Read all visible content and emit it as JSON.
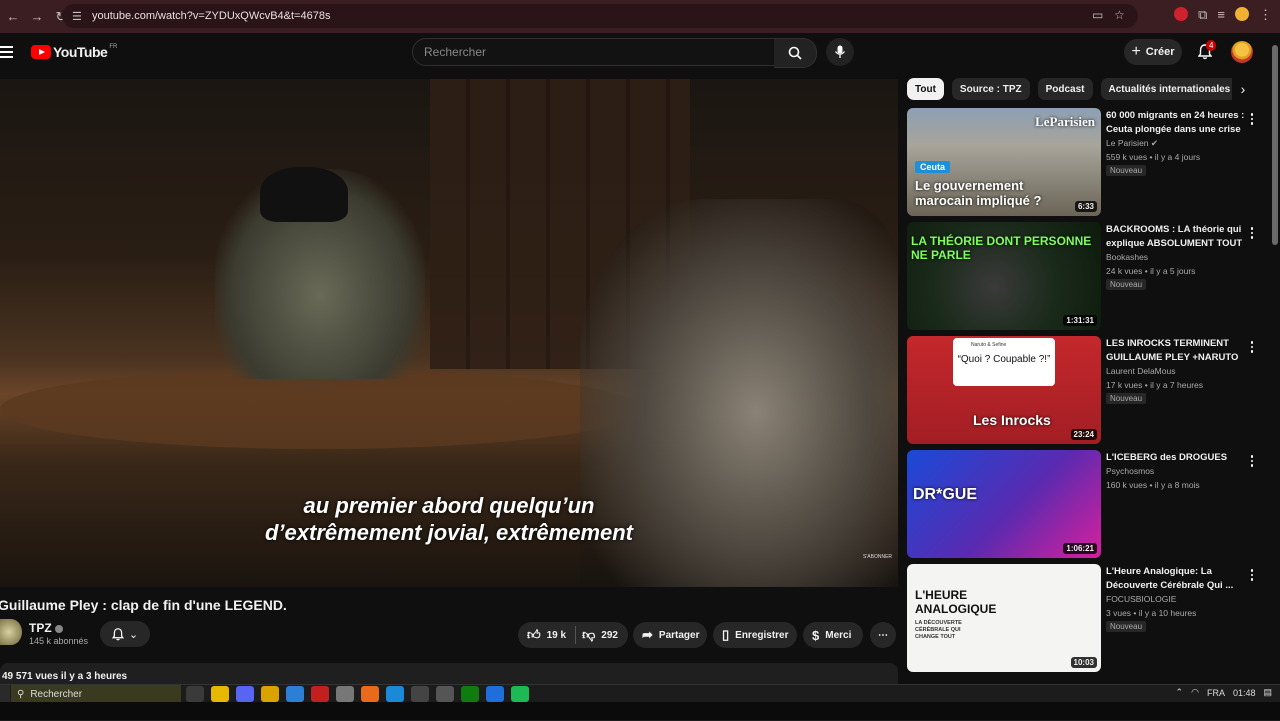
{
  "browser": {
    "url": "youtube.com/watch?v=ZYDUxQWcvB4&t=4678s"
  },
  "header": {
    "logo_text": "YouTube",
    "logo_region": "FR",
    "search_placeholder": "Rechercher",
    "create_label": "Créer",
    "notification_count": "4"
  },
  "player": {
    "subtitle_line1": "au premier abord quelqu’un",
    "subtitle_line2": "d’extrêmement jovial, extrêmement",
    "watermark": "S'ABONNER"
  },
  "video": {
    "title": "Guillaume Pley : clap de fin d'une LEGEND.",
    "channel_name": "TPZ",
    "subscribers": "145 k abonnés",
    "likes": "19 k",
    "dislikes": "292",
    "share_label": "Partager",
    "save_label": "Enregistrer",
    "thanks_label": "Merci",
    "stats": "49 571 vues  il y a 3 heures"
  },
  "chips": [
    "Tout",
    "Source : TPZ",
    "Podcast",
    "Actualités internationales"
  ],
  "recommendations": [
    {
      "title": "60 000 migrants en 24 heures : Ceuta plongée dans une crise ...",
      "channel": "Le Parisien",
      "meta": "559 k vues • il y a 4 jours",
      "badge": "Nouveau",
      "duration": "6:33",
      "thumb_label": "Ceuta",
      "thumb_text": "Le gouvernement marocain impliqué ?",
      "thumb_brand": "LeParisien"
    },
    {
      "title": "BACKROOMS : LA théorie qui explique ABSOLUMENT TOUT ...",
      "channel": "Bookashes",
      "meta": "24 k vues • il y a 5 jours",
      "badge": "Nouveau",
      "duration": "1:31:31",
      "thumb_text": "LA THÉORIE DONT PERSONNE NE PARLE"
    },
    {
      "title": "LES INROCKS TERMINENT GUILLAUME PLEY +NARUTO E...",
      "channel": "Laurent DelaMous",
      "meta": "17 k vues • il y a 7 heures",
      "badge": "Nouveau",
      "duration": "23:24",
      "thumb_text": "“Quoi ? Coupable ?!”",
      "thumb_brand": "Les Inrocks",
      "thumb_handle": "Naruto & Sefine"
    },
    {
      "title": "L'ICEBERG des DROGUES",
      "channel": "Psychosmos",
      "meta": "160 k vues • il y a 8 mois",
      "badge": "",
      "duration": "1:06:21",
      "thumb_text": "DR*GUE"
    },
    {
      "title": "L'Heure Analogique: La Découverte Cérébrale Qui ...",
      "channel": "FOCUSBIOLOGIE",
      "meta": "3 vues • il y a 10 heures",
      "badge": "Nouveau",
      "duration": "10:03",
      "thumb_text": "L'HEURE ANALOGIQUE",
      "thumb_sub": "LA DÉCOUVERTE CÉRÉBRALE QUI CHANGE TOUT"
    }
  ],
  "taskbar": {
    "search_label": "Rechercher",
    "language": "FRA",
    "time": "01:48"
  }
}
